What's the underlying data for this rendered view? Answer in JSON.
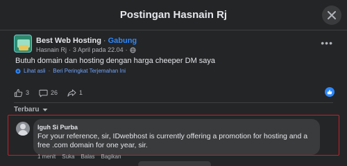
{
  "dialog": {
    "title": "Postingan Hasnain Rj",
    "close_icon": "close-icon"
  },
  "post": {
    "page_name": "Best Web Hosting",
    "separator": "·",
    "join_label": "Gabung",
    "author": "Hasnain Rj",
    "meta_separator": "·",
    "date": "3 April pada 22.04",
    "meta_separator_2": "·",
    "privacy_icon": "globe-icon",
    "more_icon": "more-dots-icon",
    "more_label": "•••",
    "text": "Butuh domain dan hosting dengan harga cheeper DM saya",
    "see_original": "Lihat asli",
    "translate_separator": "·",
    "rate_translation": "Beri Peringkat Terjemahan Ini",
    "stats": {
      "likes": "3",
      "comments": "26",
      "shares": "1"
    }
  },
  "comments": {
    "sort_label": "Terbaru",
    "items": [
      {
        "author": "Iguh Si Purba",
        "text": "For your reference, sir, IDwebhost is currently offering a promotion for hosting and a free .com domain for one year, sir.",
        "time": "1 menit",
        "like_action": "Suka",
        "reply_action": "Balas",
        "share_action": "Bagikan"
      }
    ]
  },
  "colors": {
    "background": "#242526",
    "accent": "#2d88ff",
    "highlight_border": "#c5202b",
    "bubble": "#3a3b3c"
  }
}
